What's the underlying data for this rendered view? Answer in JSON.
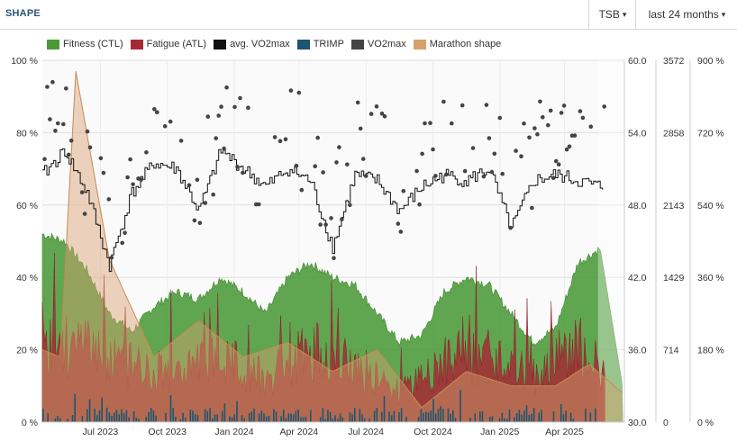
{
  "header": {
    "title": "SHAPE",
    "metric_select": "TSB",
    "range_select": "last 24 months",
    "caret": "▾"
  },
  "legend": [
    {
      "label": "Fitness (CTL)",
      "color": "#4a9a38"
    },
    {
      "label": "Fatigue (ATL)",
      "color": "#a52a35"
    },
    {
      "label": "avg. VO2max",
      "color": "#111111"
    },
    {
      "label": "TRIMP",
      "color": "#1c5670"
    },
    {
      "label": "VO2max",
      "color": "#444444"
    },
    {
      "label": "Marathon shape",
      "color": "#d9a06e"
    }
  ],
  "chart_data": {
    "type": "area",
    "x_ticks": [
      "Jul 2023",
      "Oct 2023",
      "Jan 2024",
      "Apr 2024",
      "Jul 2024",
      "Oct 2024",
      "Jan 2025",
      "Apr 2025"
    ],
    "y_axes": {
      "percent_left": {
        "ticks": [
          "0 %",
          "20 %",
          "40 %",
          "60 %",
          "80 %",
          "100 %"
        ],
        "range": [
          0,
          100
        ]
      },
      "vo2max": {
        "ticks": [
          "30.0",
          "36.0",
          "42.0",
          "48.0",
          "54.0",
          "60.0"
        ],
        "range": [
          30,
          60
        ]
      },
      "trimp": {
        "ticks": [
          "0",
          "714",
          "1429",
          "2143",
          "2858",
          "3572"
        ],
        "range": [
          0,
          3572
        ]
      },
      "percent_right": {
        "ticks": [
          "0 %",
          "180 %",
          "360 %",
          "540 %",
          "720 %",
          "900 %"
        ],
        "range": [
          0,
          900
        ]
      }
    },
    "grid": true,
    "legend_position": "top-left",
    "series": [
      {
        "name": "Fitness (CTL)",
        "unit": "%",
        "months_from_start": [
          0,
          1,
          2,
          3,
          4,
          5,
          6,
          7,
          8,
          9,
          10,
          11,
          12,
          13,
          14,
          15,
          16,
          17,
          18,
          19,
          20,
          21,
          22,
          23,
          24,
          25,
          26
        ],
        "values": [
          52,
          50,
          42,
          30,
          25,
          32,
          36,
          34,
          40,
          36,
          30,
          40,
          44,
          40,
          38,
          30,
          22,
          24,
          36,
          40,
          38,
          30,
          22,
          26,
          44,
          48,
          10
        ]
      },
      {
        "name": "Fatigue (ATL)",
        "unit": "%",
        "months_from_start": [
          0,
          2,
          4,
          6,
          8,
          10,
          12,
          14,
          16,
          18,
          20,
          22,
          24,
          25,
          26
        ],
        "values": [
          22,
          20,
          16,
          14,
          18,
          12,
          20,
          16,
          8,
          16,
          18,
          12,
          22,
          14,
          4
        ]
      },
      {
        "name": "avg. VO2max",
        "unit": "VO2max",
        "months_from_start": [
          0,
          1,
          2,
          3,
          4,
          5,
          6,
          7,
          8,
          9,
          10,
          11,
          12,
          13,
          14,
          15,
          16,
          17,
          18,
          19,
          20,
          21,
          22,
          23,
          24,
          25
        ],
        "values": [
          50.5,
          52.5,
          49.0,
          43.0,
          49.0,
          51.5,
          51.0,
          47.5,
          52.5,
          51.0,
          49.5,
          51.0,
          50.0,
          44.5,
          50.5,
          50.0,
          47.5,
          49.5,
          50.5,
          50.0,
          51.0,
          46.0,
          50.0,
          50.5,
          50.0,
          49.5
        ]
      },
      {
        "name": "Marathon shape",
        "unit": "%",
        "months_from_start": [
          0,
          0.8,
          1.5,
          3,
          5,
          7,
          9,
          11,
          13,
          15,
          17,
          19,
          21,
          23,
          24.5,
          26
        ],
        "values": [
          20,
          18,
          97,
          45,
          18,
          28,
          18,
          22,
          14,
          20,
          4,
          14,
          10,
          10,
          16,
          8
        ]
      }
    ]
  }
}
